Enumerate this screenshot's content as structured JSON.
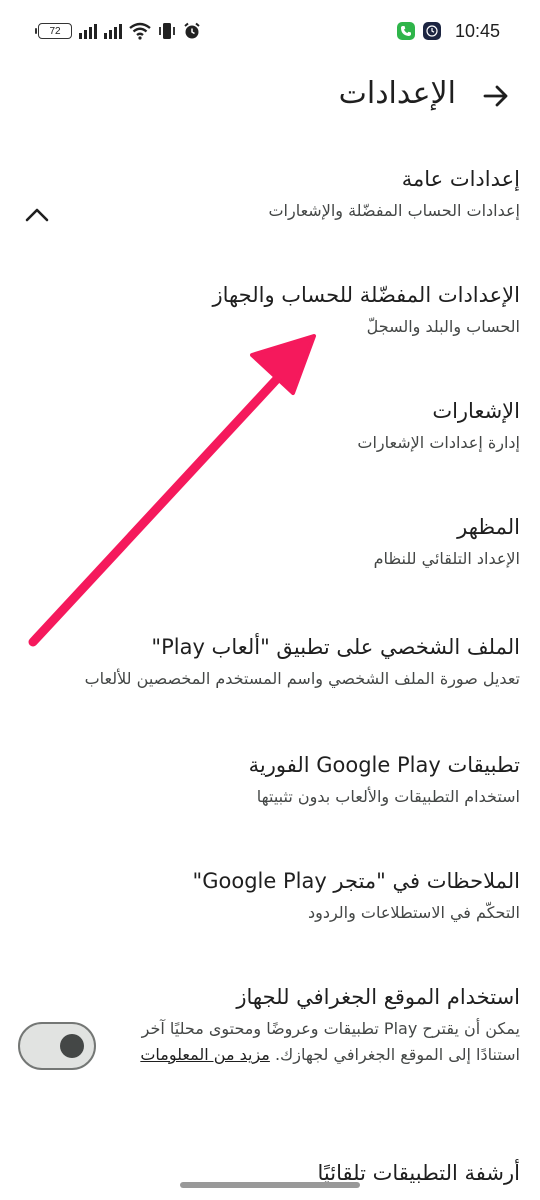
{
  "status_bar": {
    "battery_level": "72",
    "time": "10:45",
    "icons": [
      "signal-icon",
      "signal-icon",
      "wifi-icon",
      "vibrate-icon",
      "alarm-icon",
      "phone-app-icon",
      "clock-app-icon"
    ]
  },
  "header": {
    "title": "الإعدادات",
    "back_icon": "arrow-right-icon"
  },
  "items": [
    {
      "title": "إعدادات عامة",
      "subtitle": "إعدادات الحساب المفضّلة والإشعارات",
      "expanded": true
    },
    {
      "title": "الإعدادات المفضّلة للحساب والجهاز",
      "subtitle": "الحساب والبلد والسجلّ"
    },
    {
      "title": "الإشعارات",
      "subtitle": "إدارة إعدادات الإشعارات"
    },
    {
      "title": "المظهر",
      "subtitle": "الإعداد التلقائي للنظام"
    },
    {
      "title": "الملف الشخصي على تطبيق \"ألعاب Play\"",
      "subtitle": "تعديل صورة الملف الشخصي واسم المستخدم المخصصين للألعاب"
    },
    {
      "title": "تطبيقات Google Play الفورية",
      "subtitle": "استخدام التطبيقات والألعاب بدون تثبيتها"
    },
    {
      "title": "الملاحظات في \"متجر Google Play\"",
      "subtitle": "التحكّم في الاستطلاعات والردود"
    },
    {
      "title": "استخدام الموقع الجغرافي للجهاز",
      "subtitle": "يمكن أن يقترح Play تطبيقات وعروضًا ومحتوى محليًا آخر استنادًا إلى الموقع الجغرافي لجهازك.",
      "link": "مزيد من المعلومات",
      "toggle_on": false
    },
    {
      "title": "أرشفة التطبيقات تلقائيًا"
    }
  ],
  "colors": {
    "annotation_arrow": "#f5195c",
    "toggle_track": "#e1e3e1",
    "toggle_knob": "#444746"
  }
}
